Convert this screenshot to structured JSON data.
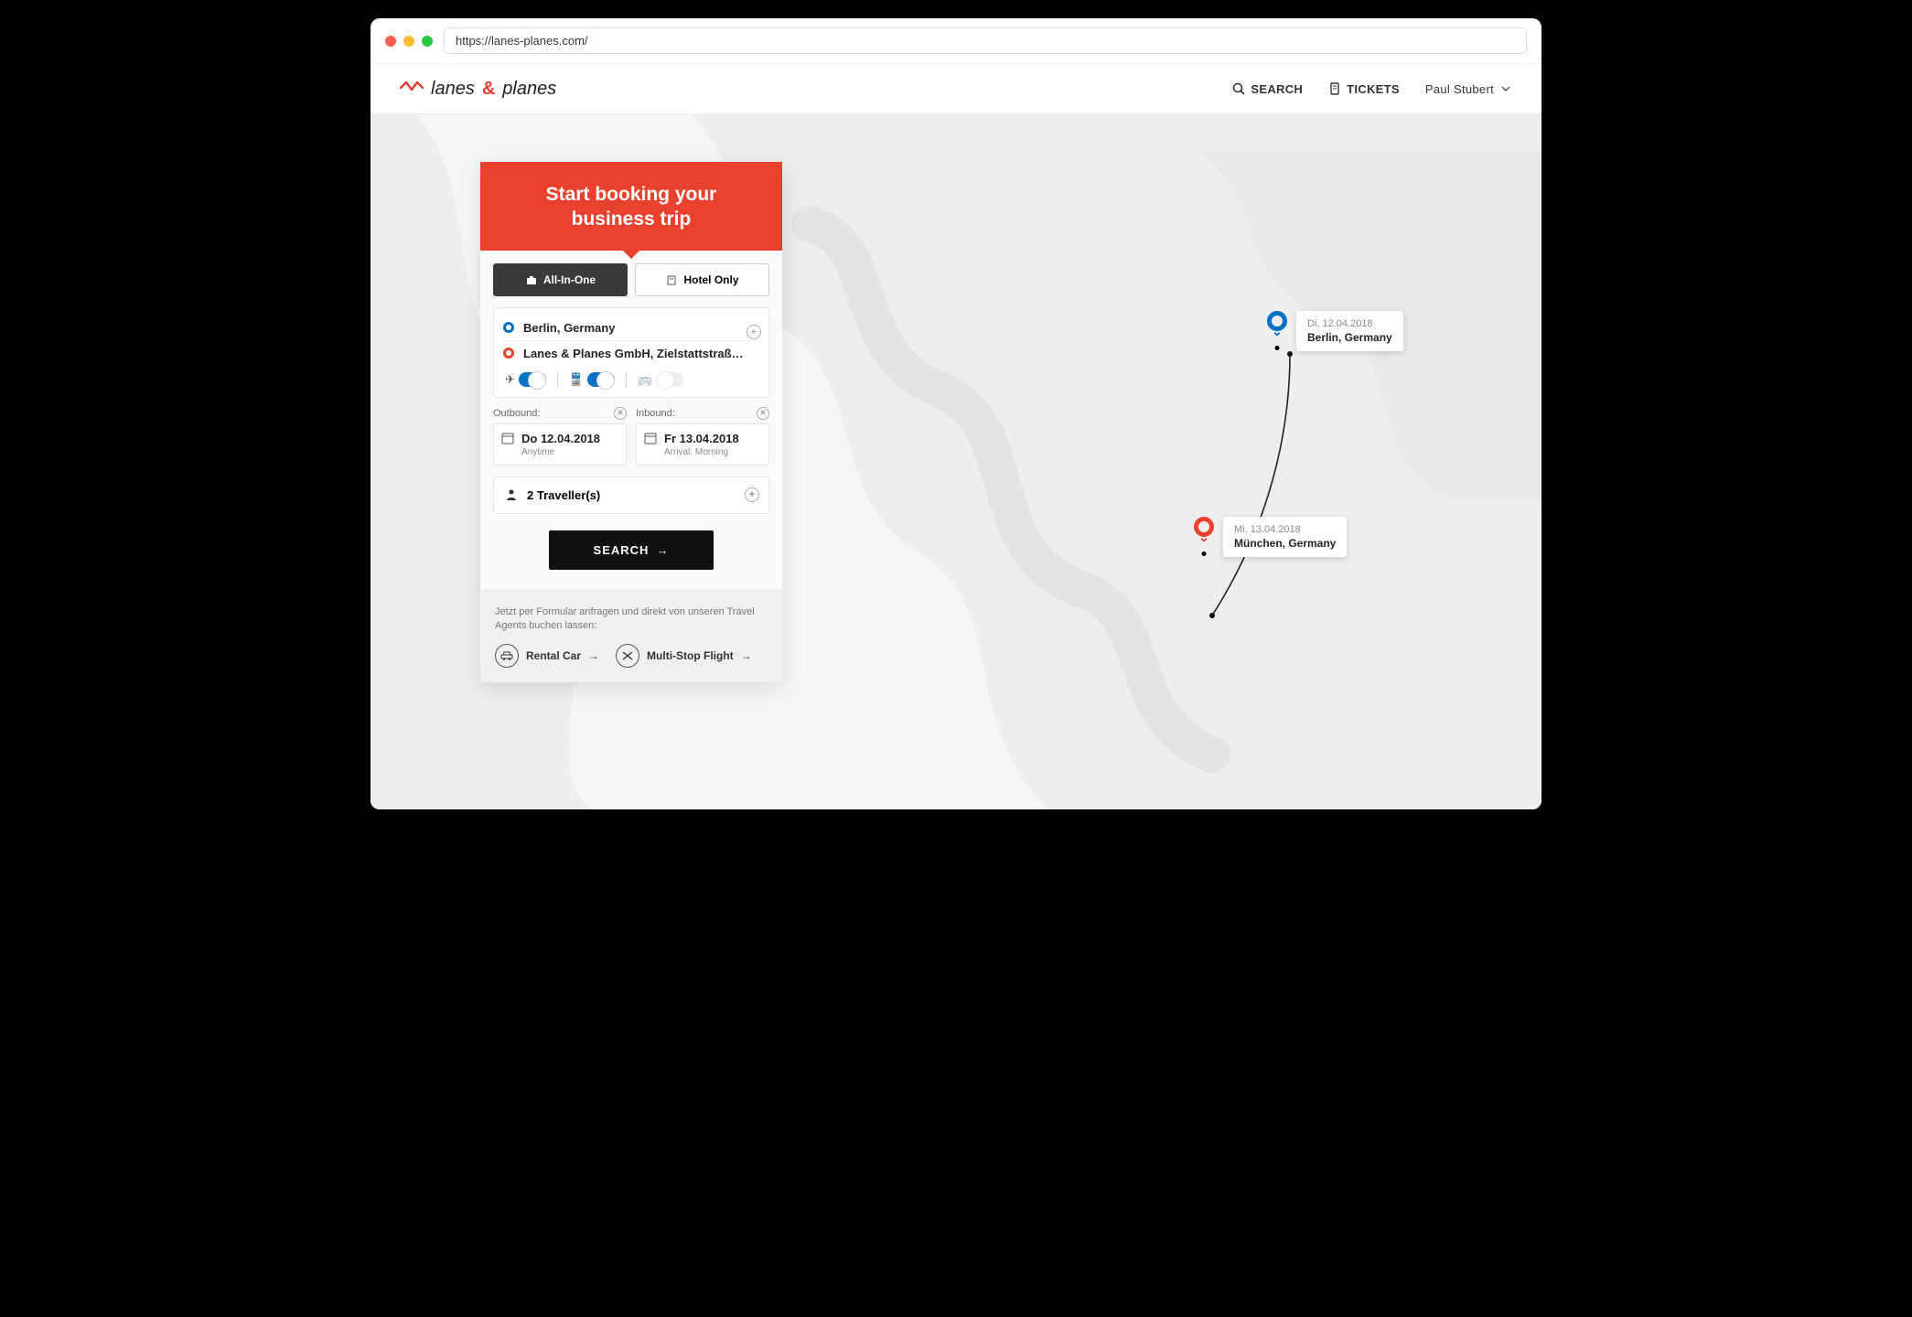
{
  "browser": {
    "url": "https://lanes-planes.com/"
  },
  "brand": {
    "name_a": "lanes",
    "amp": "&",
    "name_b": "planes"
  },
  "nav": {
    "search": "SEARCH",
    "tickets": "TICKETS",
    "user": "Paul Stubert"
  },
  "card": {
    "title_line1": "Start booking your",
    "title_line2": "business trip",
    "tabs": {
      "all": "All-In-One",
      "hotel": "Hotel Only"
    },
    "origin": "Berlin, Germany",
    "destination": "Lanes & Planes GmbH, Zielstattstraß…",
    "outbound_label": "Outbound:",
    "inbound_label": "Inbound:",
    "outbound_date": "Do 12.04.2018",
    "outbound_time": "Anytime",
    "inbound_date": "Fr 13.04.2018",
    "inbound_time": "Arrival: Morning",
    "travellers": "2 Traveller(s)",
    "search_btn": "SEARCH",
    "footer_hint": "Jetzt per Formular anfragen und direkt von unseren Travel Agents buchen lassen:",
    "ql_car": "Rental Car",
    "ql_multi": "Multi-Stop Flight"
  },
  "map": {
    "origin": {
      "date": "Di, 12.04.2018",
      "city": "Berlin, Germany"
    },
    "dest": {
      "date": "Mi, 13.04.2018",
      "city": "München, Germany"
    }
  }
}
